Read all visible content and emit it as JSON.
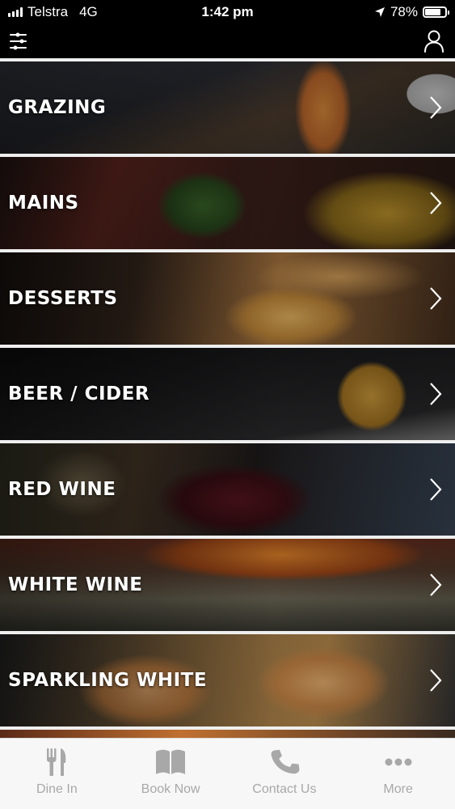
{
  "status_bar": {
    "carrier": "Telstra",
    "network": "4G",
    "time": "1:42 pm",
    "battery": "78%",
    "battery_level": 0.78
  },
  "categories": [
    {
      "label": "GRAZING"
    },
    {
      "label": "MAINS"
    },
    {
      "label": "DESSERTS"
    },
    {
      "label": "BEER / CIDER"
    },
    {
      "label": "RED WINE"
    },
    {
      "label": "WHITE WINE"
    },
    {
      "label": "SPARKLING WHITE"
    }
  ],
  "tab_bar": {
    "tabs": [
      {
        "label": "Dine In",
        "icon": "fork-knife-icon"
      },
      {
        "label": "Book Now",
        "icon": "book-icon"
      },
      {
        "label": "Contact Us",
        "icon": "phone-icon"
      },
      {
        "label": "More",
        "icon": "more-dots-icon"
      }
    ]
  },
  "colors": {
    "tab_icon": "#a8a8a8",
    "header_bg": "#000000",
    "label_text": "#ffffff"
  }
}
